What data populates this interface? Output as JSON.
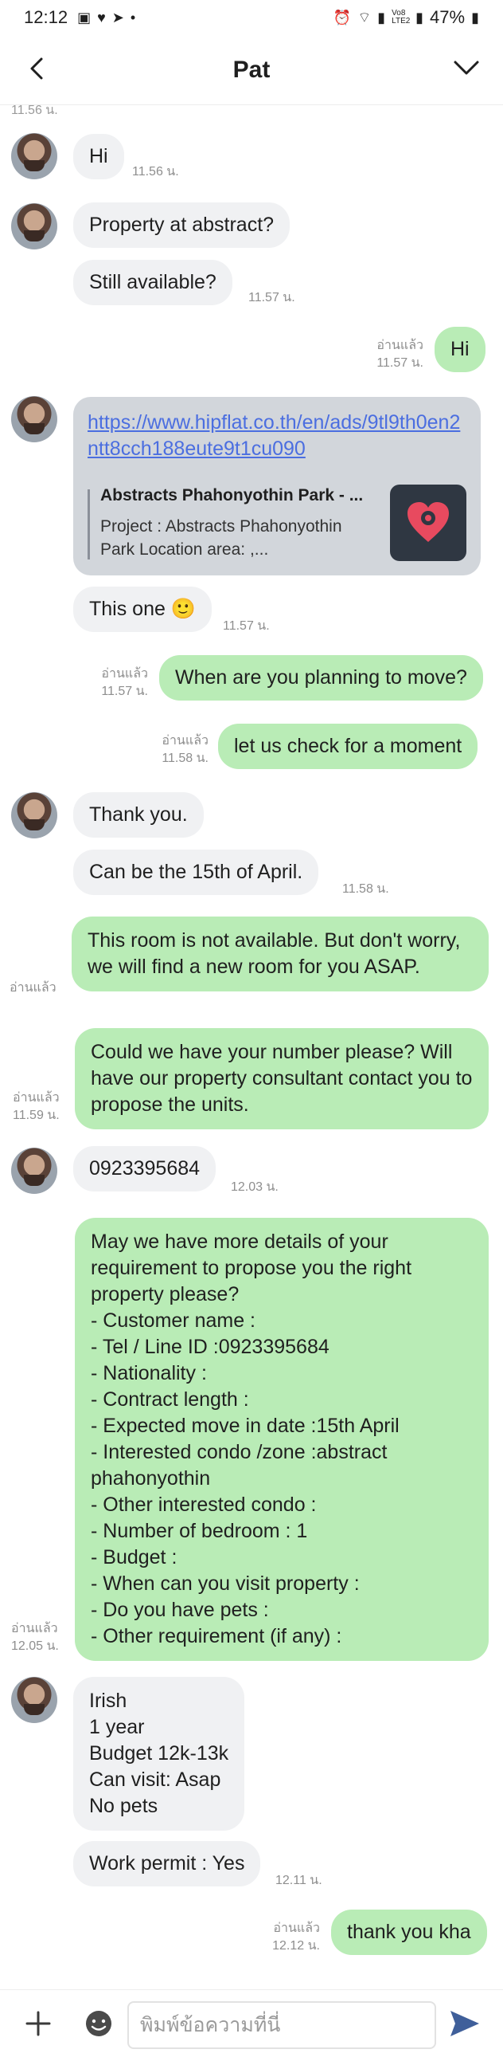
{
  "status_bar": {
    "time": "12:12",
    "battery": "47%",
    "net": "Vo8 LTE2"
  },
  "header": {
    "title": "Pat"
  },
  "chat": {
    "partial_time": "11.56 น.",
    "messages": [
      {
        "text": "Hi",
        "time": "11.56 น."
      },
      {
        "text": "Property at abstract?"
      },
      {
        "text": "Still available?",
        "time": "11.57 น."
      },
      {
        "text": "Hi",
        "read": "อ่านแล้ว",
        "time": "11.57 น."
      },
      {
        "time": "11.57 น."
      },
      {
        "text": "This one 🙂",
        "time": "11.57 น."
      },
      {
        "text": "When are you planning to move?",
        "read": "อ่านแล้ว",
        "time": "11.57 น."
      },
      {
        "text": "let us check for a moment",
        "read": "อ่านแล้ว",
        "time": "11.58 น."
      },
      {
        "text": "Thank you."
      },
      {
        "text": "Can be the 15th of April.",
        "time": "11.58 น."
      },
      {
        "text": "This room is not available.  But don't worry, we will find a new room for you ASAP.",
        "read": "อ่านแล้ว"
      },
      {
        "text": "Could we have your number please? Will have our property consultant contact you to propose the units.",
        "read": "อ่านแล้ว",
        "time": "11.59 น."
      },
      {
        "text": "0923395684",
        "time": "12.03 น."
      },
      {
        "read": "อ่านแล้ว",
        "time": "12.05 น."
      },
      {
        "text": "Irish\n1 year\nBudget 12k-13k\nCan visit: Asap\nNo pets"
      },
      {
        "text": "Work permit : Yes",
        "time": "12.11 น."
      },
      {
        "text": "thank you kha",
        "read": "อ่านแล้ว",
        "time": "12.12 น."
      }
    ],
    "link_card": {
      "url": "https://www.hipflat.co.th/en/ads/9tl9th0en2ntt8cch188eute9t1cu090",
      "title": "Abstracts Phahonyothin Park - ...",
      "desc": "Project : Abstracts Phahonyothin Park Location area: ,..."
    },
    "requirements": [
      "May we have more details of your requirement to propose you the right property please?",
      "- Customer name :",
      "- Tel / Line ID :0923395684",
      "- Nationality :",
      "- Contract length :",
      "- Expected move in date :15th April",
      "- Interested condo /zone :abstract phahonyothin",
      "- Other interested condo :",
      "- Number of bedroom  : 1",
      "- Budget :",
      "- When can you visit property :",
      "- Do you have pets :",
      "- Other requirement (if any) :"
    ]
  },
  "input": {
    "placeholder": "พิมพ์ข้อความที่นี่"
  },
  "colors": {
    "outgoing": "#b9ecb6",
    "incoming": "#f0f1f3",
    "link": "#4b6ee0",
    "send": "#3f5f9a"
  }
}
